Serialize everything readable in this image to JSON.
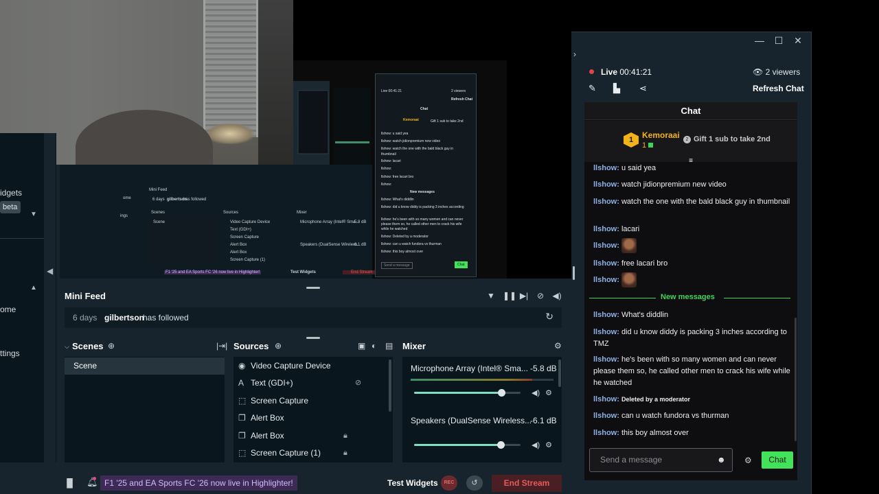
{
  "window": {
    "controls": [
      "—",
      "☐",
      "✕"
    ]
  },
  "leftnav": {
    "widgets_label": "idgets",
    "beta_label": "beta",
    "home_label": "ome",
    "settings_label": "ttings"
  },
  "preview": {
    "mini": {
      "live": "Live 00:41:21",
      "viewers": "2 viewers",
      "refresh": "Refresh Chat",
      "chat": "Chat",
      "user": "Kemoraai",
      "gift": "Gift 1 sub to take 2nd",
      "lines": [
        "llshow: u said yea",
        "llshow: watch jidionpremium new video",
        "llshow: watch the one with the bald black guy in",
        "thumbnail",
        "llshow: lacari",
        "llshow:",
        "llshow: free lacari bro",
        "llshow:",
        "New messages",
        "llshow: What's diddlin",
        "llshow: did u know diddy is packing 3 inches according",
        "llshow: he's been with so many women and can never",
        "please them so, he called other men to crack his wife",
        "while he watched",
        "llshow: Deleted by a moderator",
        "llshow: can u watch fundora vs thurman",
        "llshow: this boy almost over"
      ],
      "send": "Send a message",
      "chat_btn": "Chat",
      "minifeed": "Mini Feed",
      "feed_time": "6 days",
      "feed_user": "gilbertson",
      "feed_event": "has followed",
      "scenes": "Scenes",
      "scene": "Scene",
      "sources": "Sources",
      "mixer": "Mixer",
      "sources_list": [
        "Video Capture Device",
        "Text (GDI+)",
        "Screen Capture",
        "Alert Box",
        "Alert Box",
        "Screen Capture (1)"
      ],
      "mic": "Microphone Array (Intel® Sma...",
      "mic_db": "-5.8 dB",
      "spk": "Speakers (DualSense Wireless...",
      "spk_db": "-6.1 dB",
      "notif": "F1 '25 and EA Sports FC '26 now live in Highlighter!",
      "test": "Test Widgets",
      "end": "End Stream",
      "home": "ome",
      "settings": "ings"
    }
  },
  "minifeed": {
    "title": "Mini Feed",
    "row": {
      "time": "6 days",
      "user": "gilbertson",
      "event": "has followed"
    }
  },
  "scenes": {
    "title": "Scenes",
    "items": [
      "Scene"
    ]
  },
  "sources": {
    "title": "Sources",
    "items": [
      {
        "label": "Video Capture Device",
        "icon": "webcam-icon"
      },
      {
        "label": "Text (GDI+)",
        "icon": "text-icon"
      },
      {
        "label": "Screen Capture",
        "icon": "screen-capture-icon"
      },
      {
        "label": "Alert Box",
        "icon": "alert-box-icon"
      },
      {
        "label": "Alert Box",
        "icon": "alert-box-icon"
      },
      {
        "label": "Screen Capture (1)",
        "icon": "screen-capture-icon"
      }
    ]
  },
  "mixer": {
    "title": "Mixer",
    "channels": [
      {
        "name": "Microphone Array (Intel® Sma...",
        "db": "-5.8 dB",
        "volume": 0.82,
        "level": 0.85
      },
      {
        "name": "Speakers (DualSense Wireless...",
        "db": "-6.1 dB",
        "volume": 0.81,
        "level": 0
      }
    ]
  },
  "footer": {
    "notification": "F1 '25 and EA Sports FC '26 now live in Highlighter!",
    "test_widgets": "Test Widgets",
    "rec": "REC",
    "end_stream": "End Stream"
  },
  "chatdock": {
    "live_label": "Live",
    "live_time": "00:41:21",
    "viewers": "2 viewers",
    "refresh": "Refresh Chat",
    "header": "Chat",
    "hypetrain": {
      "rank": "1",
      "user": "Kemoraai",
      "count": "1",
      "gift_rank": "2",
      "gift_text": "Gift 1 sub to take 2nd"
    },
    "messages": [
      {
        "user": "llshow:",
        "text": "u said yea"
      },
      {
        "user": "llshow:",
        "text": "watch jidionpremium new video"
      },
      {
        "user": "llshow:",
        "text": "watch the one with the bald black guy in thumbnail"
      },
      {
        "user": "llshow:",
        "text": "lacari"
      },
      {
        "user": "llshow:",
        "text": ""
      },
      {
        "user": "llshow:",
        "text": "free lacari bro"
      },
      {
        "user": "llshow:",
        "text": ""
      }
    ],
    "new_messages_label": "New messages",
    "new_messages": [
      {
        "user": "llshow:",
        "text": "What's diddlin"
      },
      {
        "user": "llshow:",
        "text": "did u know diddy is packing 3 inches according to TMZ"
      },
      {
        "user": "llshow:",
        "text": "he's been with so many women and can never please them so, he called other men to crack his wife while he watched"
      },
      {
        "user": "llshow:",
        "text": "Deleted by a moderator"
      },
      {
        "user": "llshow:",
        "text": "can u watch fundora vs thurman"
      },
      {
        "user": "llshow:",
        "text": "this boy almost over"
      }
    ],
    "input_placeholder": "Send a message",
    "chat_button": "Chat"
  },
  "colors": {
    "app_bg": "#17242d",
    "panel_bg": "#09161d",
    "accent_green": "#42e35a",
    "live_red": "#e0444a",
    "username_blue": "#8fb0e6",
    "hype_gold": "#f2b21a"
  }
}
